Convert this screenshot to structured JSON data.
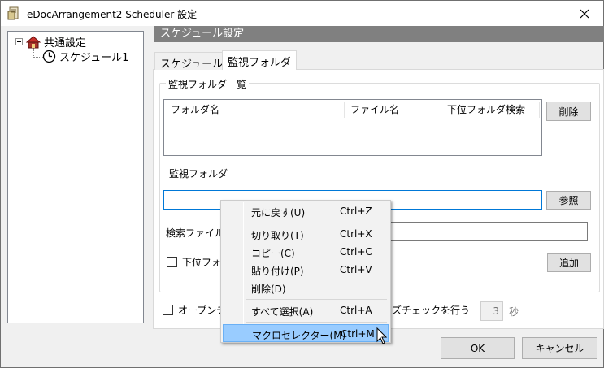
{
  "window": {
    "title": "eDocArrangement2 Scheduler 設定"
  },
  "tree": {
    "items": [
      {
        "label": "共通設定"
      },
      {
        "label": "スケジュール1"
      }
    ]
  },
  "panel": {
    "header": "スケジュール設定"
  },
  "tabs": [
    {
      "label": "スケジュール"
    },
    {
      "label": "監視フォルダ"
    }
  ],
  "group": {
    "title": "監視フォルダ一覧",
    "list_columns": [
      "フォルダ名",
      "ファイル名",
      "下位フォルダ検索"
    ],
    "delete_button": "削除",
    "watch_folder_label": "監視フォルダ",
    "watch_folder_value": "",
    "browse_button": "参照",
    "search_file_label": "検索ファイル",
    "search_file_value": "",
    "subfolder_checkbox_label": "下位フォ",
    "add_button": "追加"
  },
  "open_check": {
    "label_left": "オープンチ",
    "label_right": "ズチェックを行う",
    "seconds_value": "3",
    "seconds_unit": "秒"
  },
  "buttons": {
    "ok": "OK",
    "cancel": "キャンセル"
  },
  "context_menu": {
    "items": [
      {
        "label": "元に戻す(U)",
        "shortcut": "Ctrl+Z"
      },
      {
        "label": "切り取り(T)",
        "shortcut": "Ctrl+X"
      },
      {
        "label": "コピー(C)",
        "shortcut": "Ctrl+C"
      },
      {
        "label": "貼り付け(P)",
        "shortcut": "Ctrl+V"
      },
      {
        "label": "削除(D)",
        "shortcut": ""
      },
      {
        "label": "すべて選択(A)",
        "shortcut": "Ctrl+A"
      },
      {
        "label": "マクロセレクター(M)",
        "shortcut": "Ctrl+M"
      }
    ],
    "highlight_color": "#99ccff"
  },
  "icons": {
    "app": "app-icon",
    "close": "close-icon",
    "house": "house-icon",
    "clock": "clock-icon",
    "cursor": "mouse-pointer-icon"
  }
}
